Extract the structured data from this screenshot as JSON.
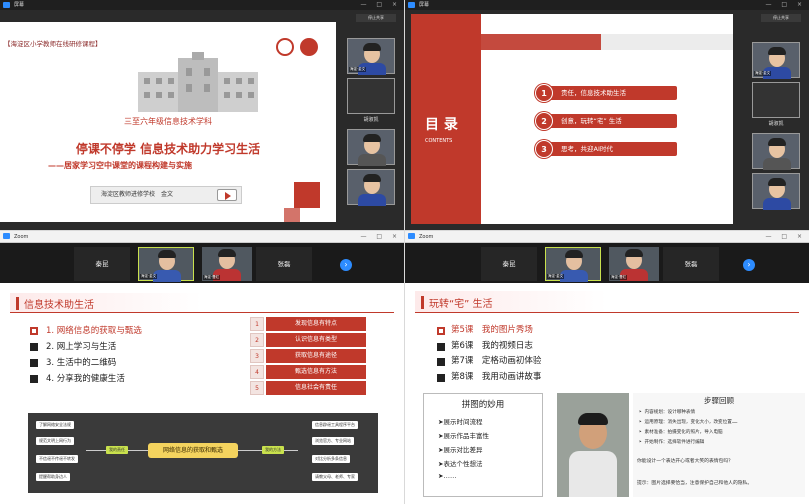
{
  "q1": {
    "titlebar": {
      "title": "屏幕",
      "btns": "— □ ×"
    },
    "slide": {
      "banner": "【海淀区小学教师在线研修课程】",
      "subject": "三至六年级信息技术学科",
      "title": "停课不停学 信息技术助力学习生活",
      "subtitle": "——居家学习空中课堂的课程构建与实施",
      "author": "海淀区教师进修学校　金文"
    },
    "videos": [
      {
        "tag": "海淀·金文",
        "name": ""
      },
      {
        "tag": "",
        "name": "胡淑凯"
      },
      {
        "tag": "",
        "name": ""
      },
      {
        "tag": "",
        "name": ""
      }
    ],
    "topbtn": "停止共享"
  },
  "q2": {
    "titlebar": {
      "title": "屏幕",
      "btns": "— □ ×"
    },
    "slide": {
      "heading": "目 录",
      "heading_sub": "CONTENTS",
      "items": [
        {
          "num": "1",
          "label": "责任，信息技术助生活"
        },
        {
          "num": "2",
          "label": "创意，玩转“宅” 生活"
        },
        {
          "num": "3",
          "label": "思考，共迎AI时代"
        }
      ]
    },
    "videos": [
      {
        "tag": "海淀·金文",
        "name": ""
      },
      {
        "tag": "",
        "name": "胡淑凯"
      },
      {
        "tag": "",
        "name": ""
      },
      {
        "tag": "",
        "name": ""
      }
    ],
    "topbtn": "停止共享"
  },
  "q3": {
    "titlebar": {
      "title": "Zoom",
      "btns": "— □ ×"
    },
    "strip": [
      {
        "label": "秦昆"
      },
      {
        "label": "",
        "tag": "海淀·金文"
      },
      {
        "label": "",
        "tag": "海淀·曹红"
      },
      {
        "label": "张磊"
      }
    ],
    "slide": {
      "title": "信息技术助生活",
      "items": [
        "1. 网络信息的获取与甄选",
        "2. 网上学习与生活",
        "3. 生活中的二维码",
        "4. 分享我的健康生活"
      ],
      "table": [
        {
          "num": "1",
          "label": "发现信息有特点"
        },
        {
          "num": "2",
          "label": "认识信息有类型"
        },
        {
          "num": "3",
          "label": "获取信息有途径"
        },
        {
          "num": "4",
          "label": "甄选信息有方法"
        },
        {
          "num": "5",
          "label": "信息社会有责任"
        }
      ],
      "mindmap": {
        "center": "网络信息的获取和甄选",
        "left_branch": "我的责任",
        "right_branch": "我的方法",
        "left_nodes": [
          "了解网络安全法规",
          "规范文明上网行为",
          "不信谣不传谣不转发",
          "提醒帮助身边人"
        ],
        "right_nodes": [
          "信息辟谣工具程序平台",
          "浏览官方、专业网站",
          "对比分析多条信息",
          "请教父母、老师、专家"
        ]
      }
    }
  },
  "q4": {
    "titlebar": {
      "title": "Zoom",
      "btns": "— □ ×"
    },
    "strip": [
      {
        "label": "秦昆"
      },
      {
        "label": "",
        "tag": "海淀·金文"
      },
      {
        "label": "",
        "tag": "海淀·曹红"
      },
      {
        "label": "张磊"
      }
    ],
    "slide": {
      "title": "玩转“宅” 生活",
      "items": [
        "第5课　我的图片秀场",
        "第6课　我的视频日志",
        "第7课　定格动画初体验",
        "第8课　我用动画讲故事"
      ],
      "box_title": "拼图的妙用",
      "box_items": [
        "➤展示时间流程",
        "➤展示作品丰富性",
        "➤展示对比差异",
        "➤表达个性想法",
        "➤……"
      ],
      "steps_title": "步骤回顾",
      "steps": [
        "➤ 内容规划：设计哪种表情",
        "➤ 运用原理：消失出现，变化大小，改变位置……",
        "➤ 素材准备：拍摄变化的照片，导入电脑",
        "➤ 开始制作：选择软件进行编辑"
      ],
      "question": "你能设计一个表达开心或者大笑的表情包吗？",
      "hint": "提示：图片选择要恰当，注意保护自己和他人的隐私。"
    }
  }
}
